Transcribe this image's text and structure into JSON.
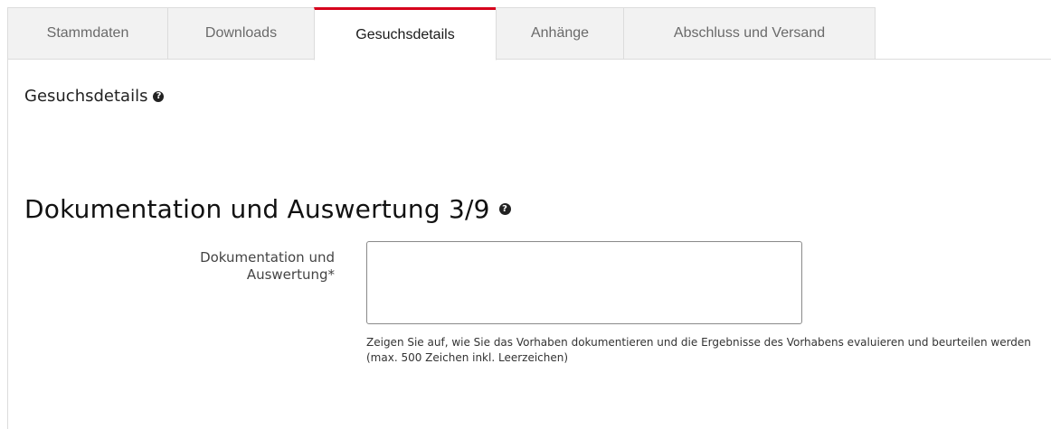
{
  "tabs": [
    {
      "label": "Stammdaten",
      "active": false
    },
    {
      "label": "Downloads",
      "active": false
    },
    {
      "label": "Gesuchsdetails",
      "active": true
    },
    {
      "label": "Anhänge",
      "active": false
    },
    {
      "label": "Abschluss und Versand",
      "active": false
    }
  ],
  "section": {
    "title": "Gesuchsdetails"
  },
  "block": {
    "title": "Dokumentation und Auswertung 3/9",
    "field_label_line1": "Dokumentation und",
    "field_label_line2": "Auswertung*",
    "field_value": "",
    "hint": "Zeigen Sie auf, wie Sie das Vorhaben dokumentieren und die Ergebnisse des Vorhabens evaluieren und beurteilen werden (max. 500 Zeichen inkl. Leerzeichen)"
  },
  "colors": {
    "active_tab_accent": "#d6001c",
    "tab_inactive_bg": "#f2f2f2",
    "border": "#dcdcdc"
  },
  "icons": {
    "help": "question-circle-icon"
  }
}
